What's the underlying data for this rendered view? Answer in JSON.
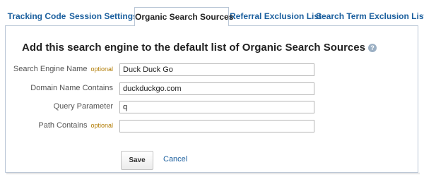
{
  "tabs": [
    {
      "label": "Tracking Code",
      "active": false
    },
    {
      "label": "Session Settings",
      "active": false
    },
    {
      "label": "Organic Search Sources",
      "active": true
    },
    {
      "label": "Referral Exclusion List",
      "active": false
    },
    {
      "label": "Search Term Exclusion List",
      "active": false
    }
  ],
  "form": {
    "heading": "Add this search engine to the default list of Organic Search Sources",
    "help_icon": "?",
    "optional_text": "optional",
    "fields": [
      {
        "label": "Search Engine Name",
        "optional": true,
        "value": "Duck Duck Go"
      },
      {
        "label": "Domain Name Contains",
        "optional": false,
        "value": "duckduckgo.com"
      },
      {
        "label": "Query Parameter",
        "optional": false,
        "value": "q"
      },
      {
        "label": "Path Contains",
        "optional": true,
        "value": ""
      }
    ],
    "save_label": "Save",
    "cancel_label": "Cancel"
  },
  "colors": {
    "link": "#1b5f9e",
    "border": "#b9c6d6",
    "optional": "#b07a00"
  }
}
